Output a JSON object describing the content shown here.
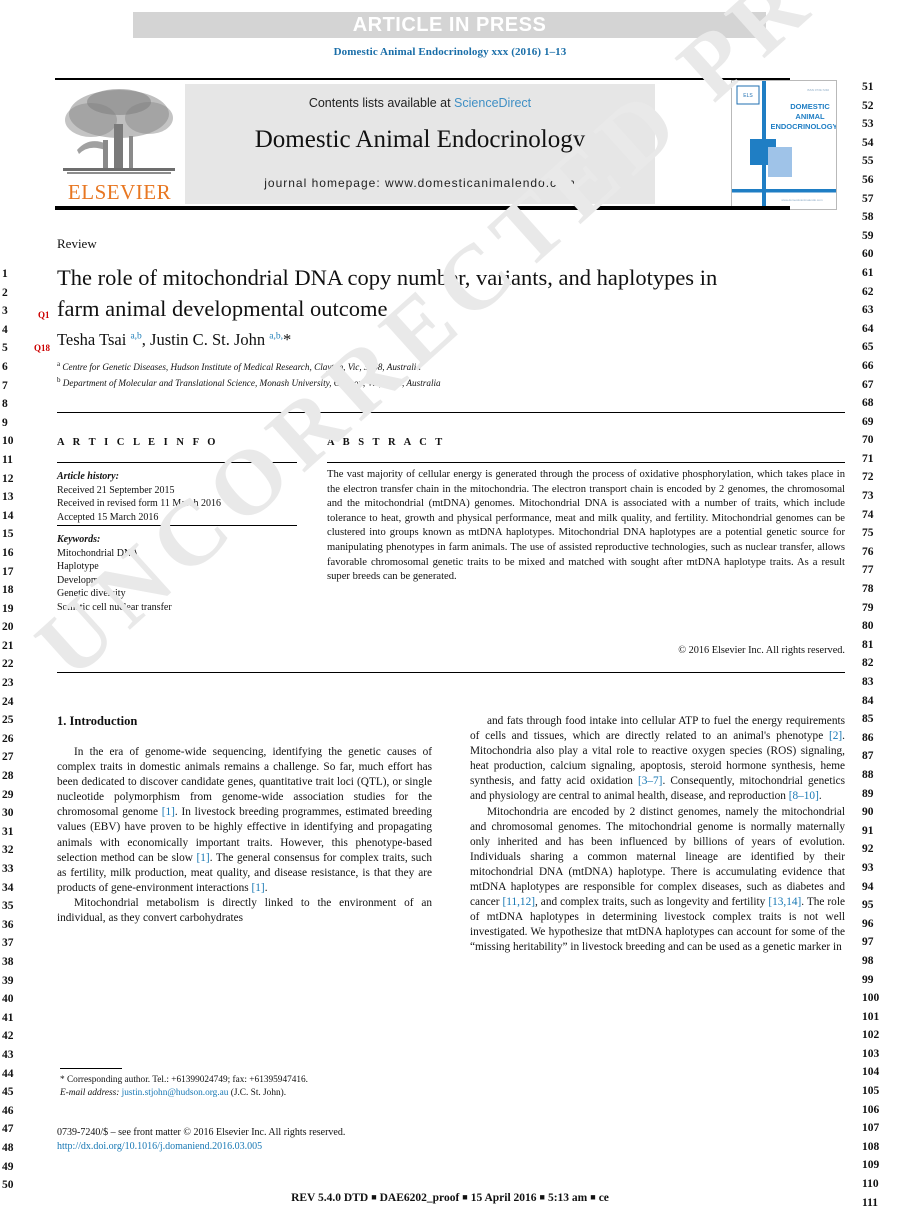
{
  "banner": {
    "press_label": "ARTICLE IN PRESS",
    "journal_ref": "Domestic Animal Endocrinology xxx (2016) 1–13"
  },
  "masthead": {
    "contents_prefix": "Contents lists available at ",
    "sciencedirect": "ScienceDirect",
    "journal_title": "Domestic Animal Endocrinology",
    "homepage": "journal homepage: www.domesticanimalendo.com",
    "publisher_wordmark": "ELSEVIER",
    "cover_title_line1": "DOMESTIC",
    "cover_title_line2": "ANIMAL",
    "cover_title_line3": "ENDOCRINOLOGY"
  },
  "article": {
    "kicker": "Review",
    "title": "The role of mitochondrial DNA copy number, variants, and haplotypes in farm animal developmental outcome",
    "authors_html": "Tesha Tsai <sup>a,b</sup>, Justin C. St. John <sup>a,b,</sup>*",
    "affiliation_a": "Centre for Genetic Diseases, Hudson Institute of Medical Research, Clayton, Vic, 3168, Australia",
    "affiliation_b": "Department of Molecular and Translational Science, Monash University, Clayton, Vic, 3168, Australia",
    "query_markers": [
      "Q1",
      "Q18"
    ]
  },
  "info": {
    "heading": "A R T I C L E   I N F O",
    "history_label": "Article history:",
    "history": [
      "Received 21 September 2015",
      "Received in revised form 11 March 2016",
      "Accepted 15 March 2016"
    ],
    "keywords_label": "Keywords:",
    "keywords": [
      "Mitochondrial DNA",
      "Haplotype",
      "Development",
      "Genetic diversity",
      "Somatic cell nuclear transfer"
    ]
  },
  "abstract": {
    "heading": "A B S T R A C T",
    "text": "The vast majority of cellular energy is generated through the process of oxidative phosphorylation, which takes place in the electron transfer chain in the mitochondria. The electron transport chain is encoded by 2 genomes, the chromosomal and the mitochondrial (mtDNA) genomes. Mitochondrial DNA is associated with a number of traits, which include tolerance to heat, growth and physical performance, meat and milk quality, and fertility. Mitochondrial genomes can be clustered into groups known as mtDNA haplotypes. Mitochondrial DNA haplotypes are a potential genetic source for manipulating phenotypes in farm animals. The use of assisted reproductive technologies, such as nuclear transfer, allows favorable chromosomal genetic traits to be mixed and matched with sought after mtDNA haplotype traits. As a result super breeds can be generated.",
    "copyright": "© 2016 Elsevier Inc. All rights reserved."
  },
  "body": {
    "section_heading": "1. Introduction",
    "left_paragraphs": [
      "In the era of genome-wide sequencing, identifying the genetic causes of complex traits in domestic animals remains a challenge. So far, much effort has been dedicated to discover candidate genes, quantitative trait loci (QTL), or single nucleotide polymorphism from genome-wide association studies for the chromosomal genome [1]. In livestock breeding programmes, estimated breeding values (EBV) have proven to be highly effective in identifying and propagating animals with economically important traits. However, this phenotype-based selection method can be slow [1]. The general consensus for complex traits, such as fertility, milk production, meat quality, and disease resistance, is that they are products of gene-environment interactions [1].",
      "Mitochondrial metabolism is directly linked to the environment of an individual, as they convert carbohydrates"
    ],
    "right_paragraphs": [
      "and fats through food intake into cellular ATP to fuel the energy requirements of cells and tissues, which are directly related to an animal's phenotype [2]. Mitochondria also play a vital role to reactive oxygen species (ROS) signaling, heat production, calcium signaling, apoptosis, steroid hormone synthesis, heme synthesis, and fatty acid oxidation [3–7]. Consequently, mitochondrial genetics and physiology are central to animal health, disease, and reproduction [8–10].",
      "Mitochondria are encoded by 2 distinct genomes, namely the mitochondrial and chromosomal genomes. The mitochondrial genome is normally maternally only inherited and has been influenced by billions of years of evolution. Individuals sharing a common maternal lineage are identified by their mitochondrial DNA (mtDNA) haplotype. There is accumulating evidence that mtDNA haplotypes are responsible for complex diseases, such as diabetes and cancer [11,12], and complex traits, such as longevity and fertility [13,14]. The role of mtDNA haplotypes in determining livestock complex traits is not well investigated. We hypothesize that mtDNA haplotypes can account for some of the “missing heritability” in livestock breeding and can be used as a genetic marker in"
    ]
  },
  "footnote": {
    "corresponding": "* Corresponding author. Tel.: +61399024749; fax: +61395947416.",
    "email_label": "E-mail address:",
    "email": "justin.stjohn@hudson.org.au",
    "email_suffix": "(J.C. St. John).",
    "front_matter": "0739-7240/$ – see front matter © 2016 Elsevier Inc. All rights reserved.",
    "doi": "http://dx.doi.org/10.1016/j.domaniend.2016.03.005"
  },
  "page_footer": {
    "parts": [
      "REV 5.4.0 DTD",
      "DAE6202_proof",
      "15 April 2016",
      "5:13 am",
      "ce"
    ]
  },
  "watermark": {
    "text": "UNCORRECTED PROOF"
  },
  "line_numbers": {
    "left_start": 1,
    "left_end": 50,
    "right_start": 51,
    "right_end": 111
  },
  "colors": {
    "link": "#1878b4",
    "banner_bg": "#d4d4d4",
    "accent_orange": "#e87722",
    "journal_ref": "#1a6ea8",
    "query_red": "#cc0000"
  }
}
